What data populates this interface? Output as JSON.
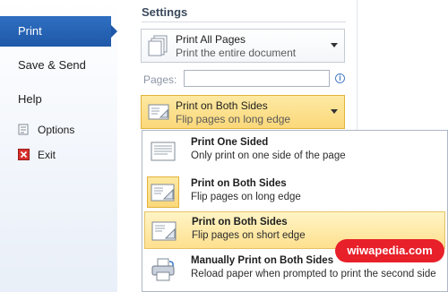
{
  "sidebar": {
    "active_item": "Print",
    "items": [
      {
        "label": "Save & Send"
      },
      {
        "label": "Help"
      }
    ],
    "sub_items": [
      {
        "label": "Options",
        "icon": "options-icon"
      },
      {
        "label": "Exit",
        "icon": "exit-icon"
      }
    ]
  },
  "settings": {
    "title": "Settings",
    "print_pages": {
      "title": "Print All Pages",
      "subtitle": "Print the entire document"
    },
    "pages_label": "Pages:",
    "pages_value": "",
    "duplex": {
      "title": "Print on Both Sides",
      "subtitle": "Flip pages on long edge"
    }
  },
  "menu": {
    "options": [
      {
        "title": "Print One Sided",
        "subtitle": "Only print on one side of the page"
      },
      {
        "title": "Print on Both Sides",
        "subtitle": "Flip pages on long edge"
      },
      {
        "title": "Print on Both Sides",
        "subtitle": "Flip pages on short edge"
      },
      {
        "title": "Manually Print on Both Sides",
        "subtitle": "Reload paper when prompted to print the second side"
      }
    ]
  },
  "watermark": "wiwapedia.com",
  "colors": {
    "accent": "#1f58a8",
    "selected": "#fbd87a",
    "watermark": "#e8202a"
  }
}
